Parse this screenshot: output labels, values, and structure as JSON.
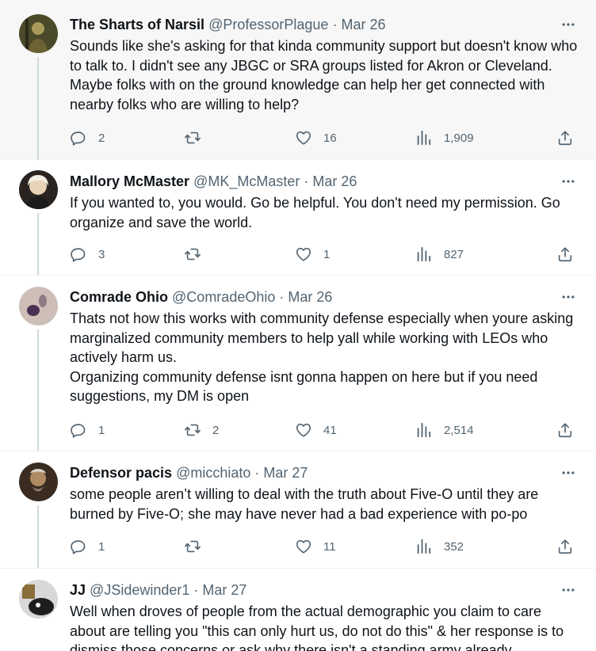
{
  "tweets": [
    {
      "name": "The Sharts of Narsil",
      "handle": "@ProfessorPlague",
      "date": "Mar 26",
      "text": "Sounds like she's asking for that kinda community support but doesn't know who to talk to. I didn't see any JBGC or SRA groups listed for Akron or Cleveland. Maybe folks with on the ground knowledge can help her get connected with nearby folks who are willing to help?",
      "replies": "2",
      "retweets": "",
      "likes": "16",
      "views": "1,909"
    },
    {
      "name": "Mallory McMaster",
      "handle": "@MK_McMaster",
      "date": "Mar 26",
      "text": "If you wanted to, you would. Go be helpful. You don't need my permission. Go organize and save the world.",
      "replies": "3",
      "retweets": "",
      "likes": "1",
      "views": "827"
    },
    {
      "name": "Comrade Ohio",
      "handle": "@ComradeOhio",
      "date": "Mar 26",
      "text": "Thats not how this works with community defense especially when youre asking marginalized community members to help yall while working with LEOs who actively harm us.\nOrganizing community defense isnt gonna happen on here but if you need suggestions, my DM is open",
      "replies": "1",
      "retweets": "2",
      "likes": "41",
      "views": "2,514"
    },
    {
      "name": "Defensor pacis",
      "handle": "@micchiato",
      "date": "Mar 27",
      "text": "some people aren’t willing to deal with the truth about Five-O until they are burned by Five-O; she may have never had a bad experience with po-po",
      "replies": "1",
      "retweets": "",
      "likes": "11",
      "views": "352"
    },
    {
      "name": "JJ",
      "handle": "@JSidewinder1",
      "date": "Mar 27",
      "text": "Well when droves of people from the actual demographic you claim to care about are telling you \"this can only hurt us, do not do this\" & her response is to dismiss those concerns or ask why there isn't a standing army already",
      "replies": "",
      "retweets": "",
      "likes": "",
      "views": ""
    }
  ],
  "separator": "·",
  "icons": {
    "more": "more-horizontal-icon",
    "reply": "reply-icon",
    "retweet": "retweet-icon",
    "like": "heart-icon",
    "views": "views-chart-icon",
    "share": "share-icon"
  },
  "colors": {
    "text": "#0f1419",
    "secondary": "#536471",
    "thread_line": "#cfd9de",
    "highlight_bg": "#f7f7f7"
  }
}
